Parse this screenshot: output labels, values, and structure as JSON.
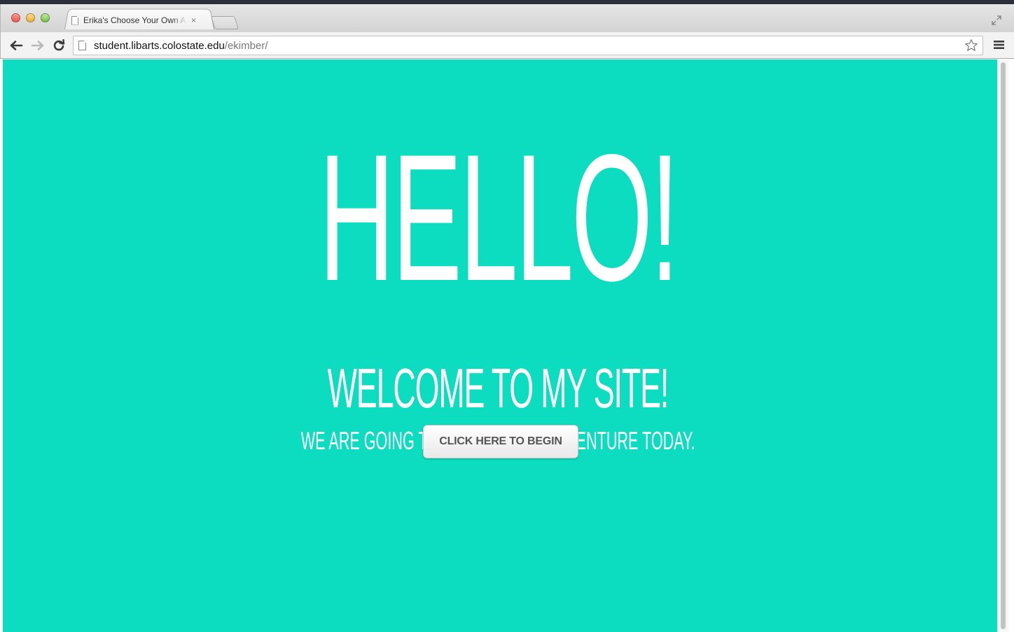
{
  "browser": {
    "tab": {
      "title": "Erika's Choose Your Own A",
      "close_glyph": "×",
      "favicon": "page-icon"
    },
    "address": {
      "host": "student.libarts.colostate.edu",
      "path": "/ekimber/"
    },
    "icons": {
      "back": "back-arrow-icon",
      "forward": "forward-arrow-icon",
      "reload": "reload-icon",
      "bookmark": "star-icon",
      "menu": "hamburger-menu-icon",
      "fullscreen": "fullscreen-icon"
    }
  },
  "page": {
    "background_color": "#0cdcbf",
    "text_color": "#ffffff",
    "heading": "HELLO!",
    "subheading": "WELCOME TO MY SITE!",
    "tagline": "WE ARE GOING TO GO ON A FUN ADVENTURE TODAY.",
    "cta_label": "CLICK HERE TO BEGIN"
  }
}
